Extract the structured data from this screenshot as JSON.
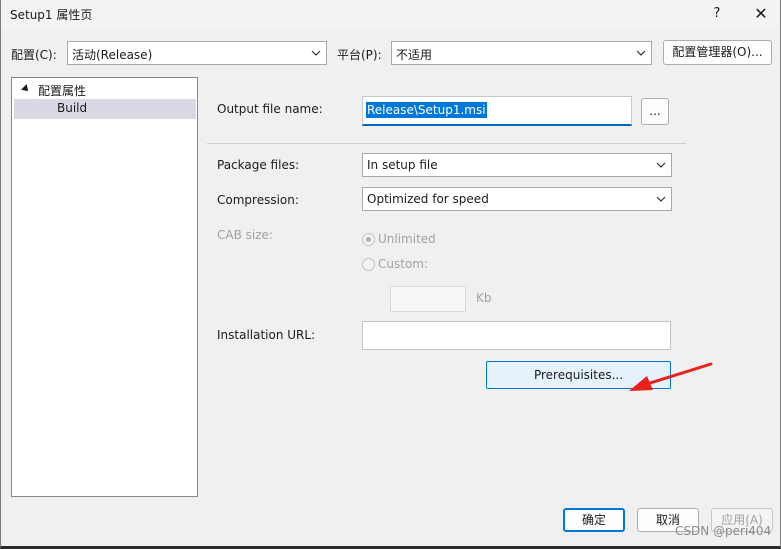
{
  "window": {
    "title": "Setup1 属性页",
    "help_label": "?",
    "close_label": "✕"
  },
  "config_bar": {
    "config_label": "配置(C):",
    "config_value": "活动(Release)",
    "platform_label": "平台(P):",
    "platform_value": "不适用",
    "config_manager_label": "配置管理器(O)..."
  },
  "tree": {
    "root_label": "配置属性",
    "child_label": "Build"
  },
  "form": {
    "output_label": "Output file name:",
    "output_value": "Release\\Setup1.msi",
    "browse_label": "...",
    "package_label": "Package files:",
    "package_value": "In setup file",
    "compression_label": "Compression:",
    "compression_value": "Optimized for speed",
    "cab_label": "CAB size:",
    "unlimited_label": "Unlimited",
    "custom_label": "Custom:",
    "kb_label": "Kb",
    "install_url_label": "Installation URL:",
    "install_url_value": "",
    "prerequisites_label": "Prerequisites..."
  },
  "footer": {
    "ok_label": "确定",
    "cancel_label": "取消",
    "apply_label": "应用(A)",
    "watermark": "CSDN @peri404"
  },
  "colors": {
    "accent": "#0078d7",
    "annotation_arrow": "#e8211c"
  },
  "icons": {
    "tree_expand": "triangle-expanded-icon",
    "dropdown": "chevron-down-icon"
  }
}
